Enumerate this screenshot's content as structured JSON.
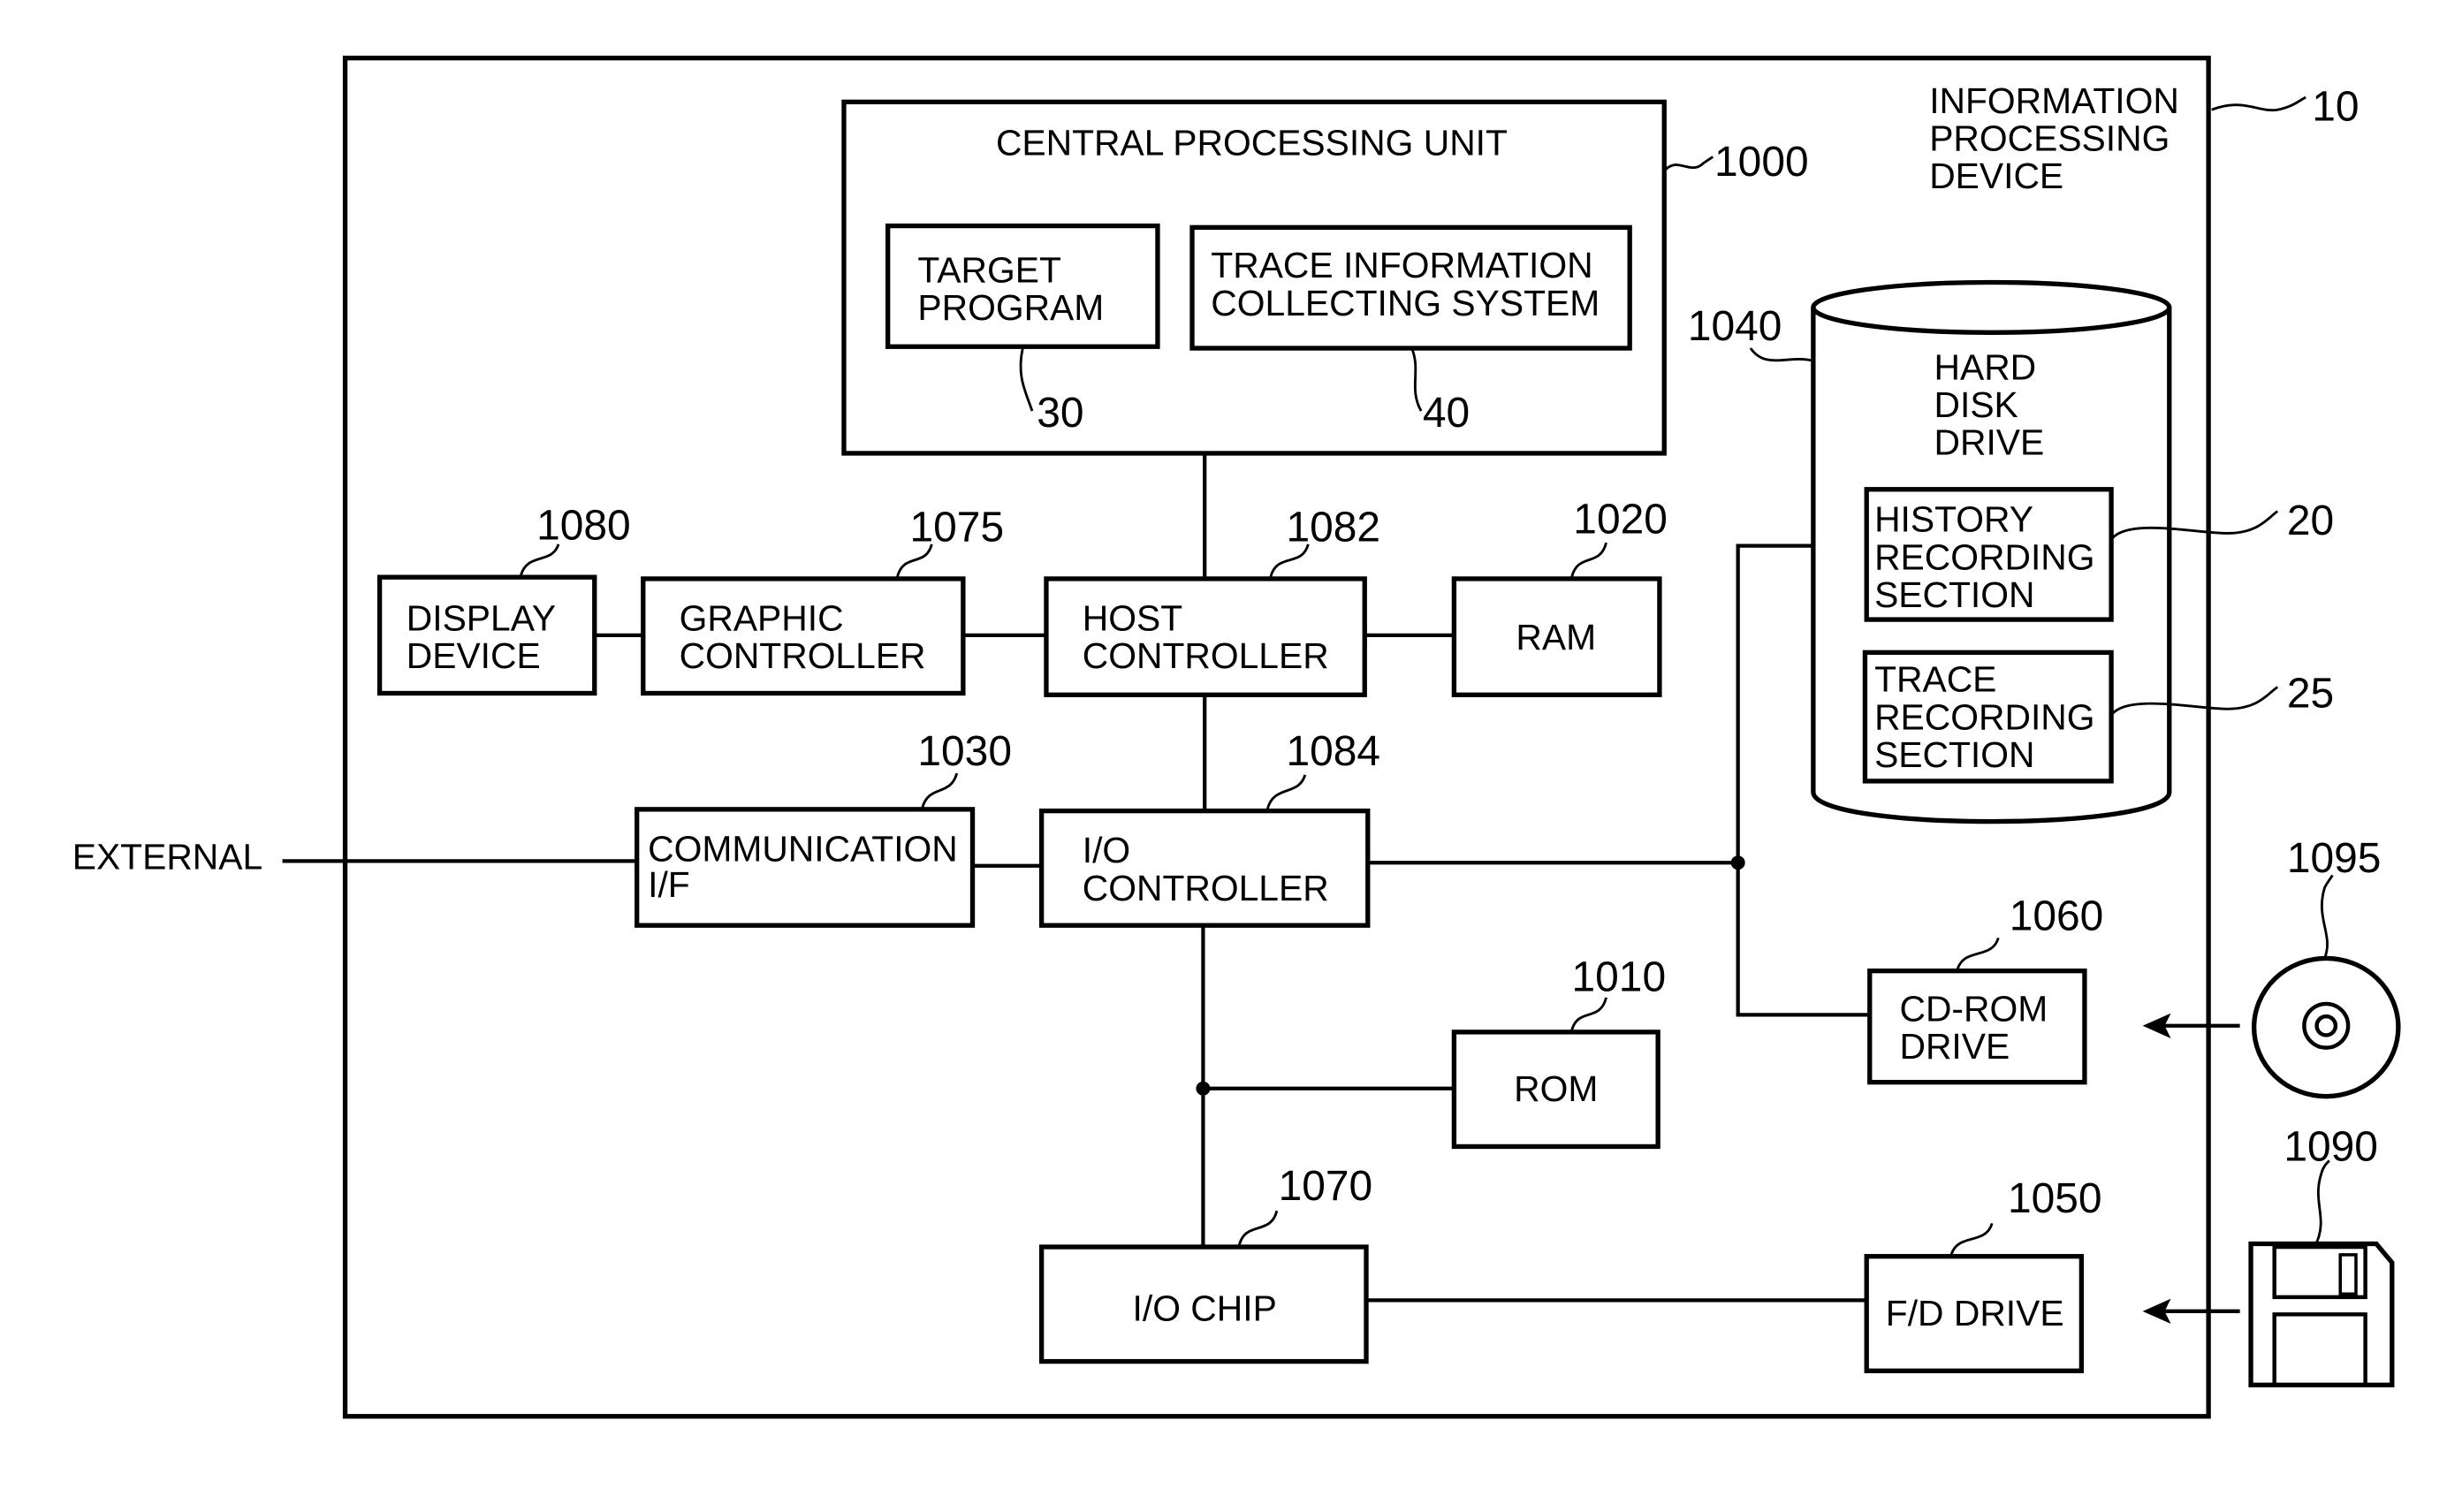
{
  "diagram": {
    "device": {
      "label_lines": [
        "INFORMATION",
        "PROCESSING",
        "DEVICE"
      ],
      "ref": "10"
    },
    "external_label": "EXTERNAL",
    "cpu": {
      "label": "CENTRAL PROCESSING UNIT",
      "ref": "1000",
      "target_program": {
        "label_lines": [
          "TARGET",
          "PROGRAM"
        ],
        "ref": "30"
      },
      "trace_system": {
        "label_lines": [
          "TRACE INFORMATION",
          "COLLECTING SYSTEM"
        ],
        "ref": "40"
      }
    },
    "hdd": {
      "label_lines": [
        "HARD",
        "DISK",
        "DRIVE"
      ],
      "ref": "1040",
      "history": {
        "label_lines": [
          "HISTORY",
          "RECORDING",
          "SECTION"
        ],
        "ref": "20"
      },
      "trace": {
        "label_lines": [
          "TRACE",
          "RECORDING",
          "SECTION"
        ],
        "ref": "25"
      }
    },
    "display_device": {
      "label_lines": [
        "DISPLAY",
        "DEVICE"
      ],
      "ref": "1080"
    },
    "graphic_controller": {
      "label_lines": [
        "GRAPHIC",
        "CONTROLLER"
      ],
      "ref": "1075"
    },
    "host_controller": {
      "label_lines": [
        "HOST",
        "CONTROLLER"
      ],
      "ref": "1082"
    },
    "ram": {
      "label": "RAM",
      "ref": "1020"
    },
    "comm_if": {
      "label_lines": [
        "COMMUNICATION",
        "I/F"
      ],
      "ref": "1030"
    },
    "io_controller": {
      "label_lines": [
        "I/O",
        "CONTROLLER"
      ],
      "ref": "1084"
    },
    "rom": {
      "label": "ROM",
      "ref": "1010"
    },
    "io_chip": {
      "label": "I/O CHIP",
      "ref": "1070"
    },
    "cdrom_drive": {
      "label_lines": [
        "CD-ROM",
        "DRIVE"
      ],
      "ref": "1060"
    },
    "fd_drive": {
      "label": "F/D DRIVE",
      "ref": "1050"
    },
    "cd_rom": {
      "ref": "1095"
    },
    "floppy": {
      "ref": "1090"
    }
  }
}
